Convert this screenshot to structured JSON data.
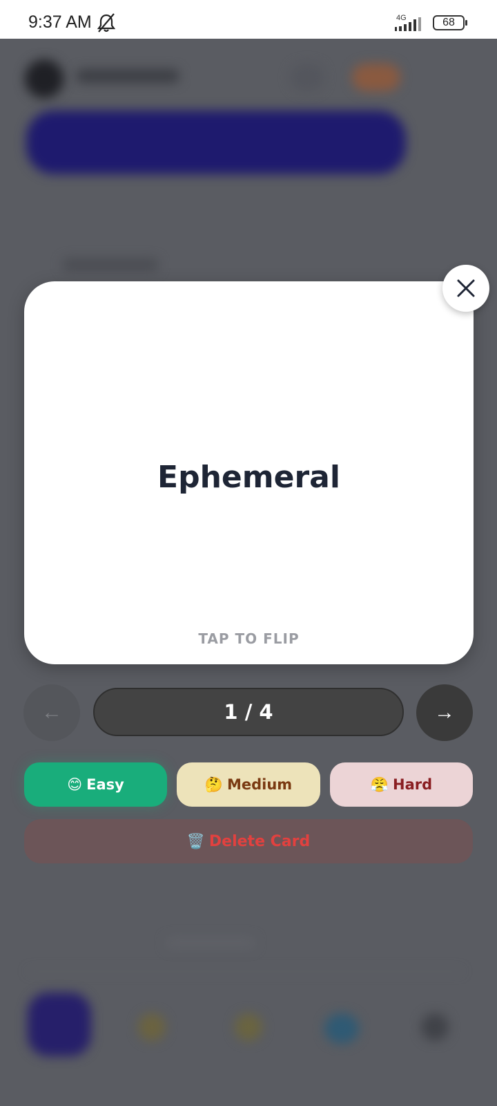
{
  "status_bar": {
    "time": "9:37 AM",
    "network": "4G",
    "battery": "68",
    "icons": [
      "bell-off-icon",
      "signal-icon",
      "battery-icon"
    ]
  },
  "flashcard": {
    "word": "Ephemeral",
    "hint": "TAP TO FLIP"
  },
  "navigation": {
    "prev_label": "←",
    "counter": "1 / 4",
    "next_label": "→"
  },
  "difficulty": {
    "easy": {
      "emoji": "😊",
      "label": "Easy",
      "color": "#19ad7b"
    },
    "medium": {
      "emoji": "🤔",
      "label": "Medium",
      "color": "#ede3ba"
    },
    "hard": {
      "emoji": "😤",
      "label": "Hard",
      "color": "#ecd4d6"
    }
  },
  "delete": {
    "emoji": "🗑️",
    "label": "Delete Card",
    "color": "#e2413f"
  },
  "close_icon": "close-icon"
}
